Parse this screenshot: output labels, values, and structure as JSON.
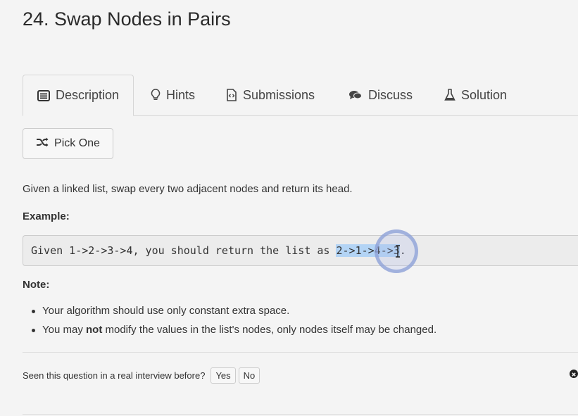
{
  "problem": {
    "title": "24. Swap Nodes in Pairs"
  },
  "tabs": [
    {
      "label": "Description",
      "icon": "description-icon",
      "active": true
    },
    {
      "label": "Hints",
      "icon": "lightbulb-icon"
    },
    {
      "label": "Submissions",
      "icon": "code-file-icon"
    },
    {
      "label": "Discuss",
      "icon": "comments-icon"
    },
    {
      "label": "Solution",
      "icon": "flask-icon"
    }
  ],
  "pick_one": {
    "label": "Pick One",
    "icon": "shuffle-icon"
  },
  "content": {
    "description": "Given a linked list, swap every two adjacent nodes and return its head.",
    "example_heading": "Example:",
    "example_code_prefix": "Given 1->2->3->4, you should return the list as ",
    "example_code_selected": "2->1->4->3",
    "example_code_suffix": ".",
    "note_heading": "Note:",
    "notes": [
      {
        "text": "Your algorithm should use only constant extra space."
      },
      {
        "before": "You may ",
        "bold": "not",
        "after": " modify the values in the list's nodes, only nodes itself may be changed."
      }
    ]
  },
  "feedback": {
    "question": "Seen this question in a real interview before?",
    "yes_label": "Yes",
    "no_label": "No"
  },
  "colors": {
    "background": "#f4f4f4",
    "selection": "#b3d4f5",
    "code_background": "#ececec"
  }
}
